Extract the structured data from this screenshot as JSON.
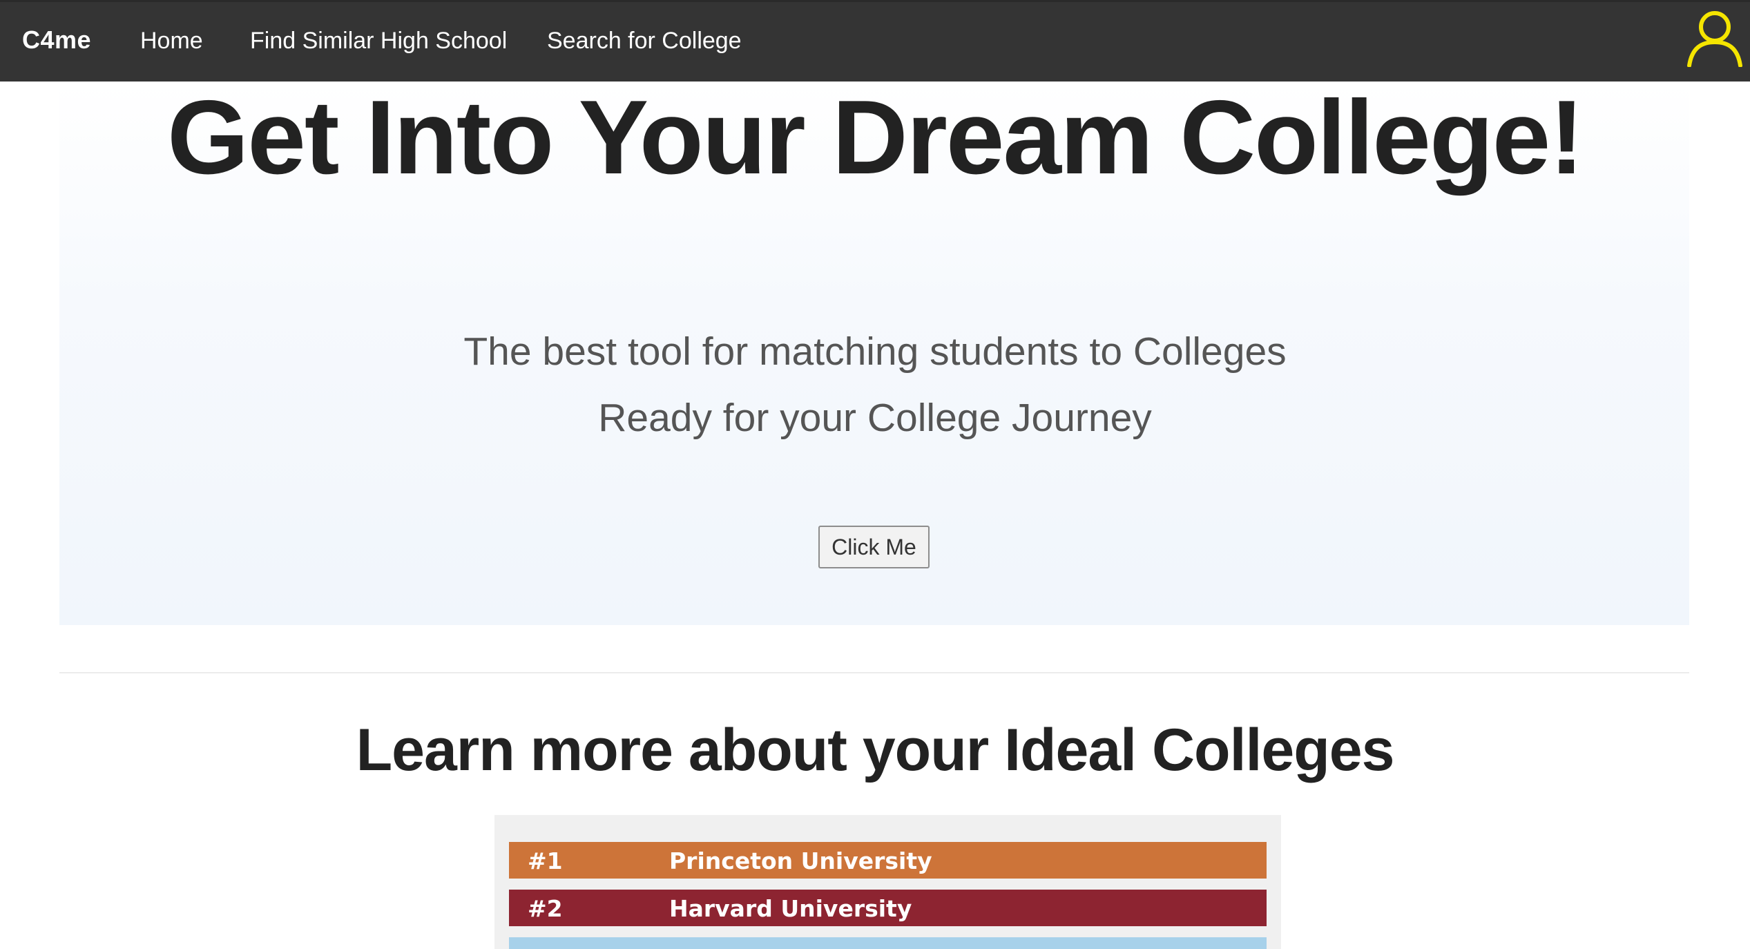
{
  "nav": {
    "brand": "C4me",
    "links": [
      "Home",
      "Find Similar High School",
      "Search for College"
    ],
    "user_icon": "user-icon",
    "user_icon_color": "#f5e500",
    "background": "#343434"
  },
  "hero": {
    "title": "Get Into Your Dream College!",
    "subtitle_1": "The best tool for matching students to Colleges",
    "subtitle_2": "Ready for your College Journey",
    "button_label": "Click Me"
  },
  "section": {
    "title": "Learn more about your Ideal Colleges",
    "rankings": [
      {
        "rank": "#1",
        "name": "Princeton University",
        "color": "#cd7439"
      },
      {
        "rank": "#2",
        "name": "Harvard University",
        "color": "#8d2431"
      },
      {
        "rank": "",
        "name": "",
        "color": "#a7d1ea"
      }
    ]
  }
}
